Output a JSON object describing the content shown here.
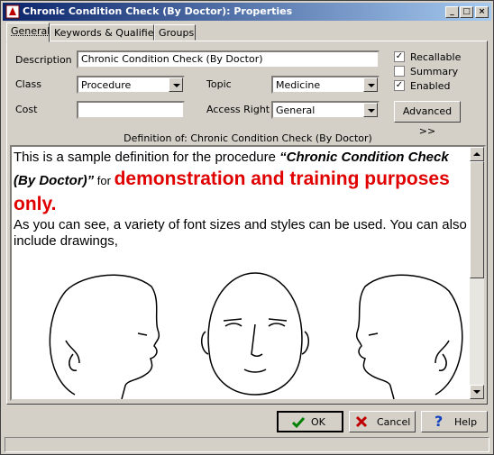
{
  "window": {
    "title": "Chronic Condition Check (By Doctor): Properties",
    "controls": [
      "_",
      "□",
      "×"
    ]
  },
  "tabs": [
    {
      "label": "General",
      "active": true
    },
    {
      "label": "Keywords & Qualifiers",
      "active": false
    },
    {
      "label": "Groups",
      "active": false
    }
  ],
  "form": {
    "description_label": "Description",
    "description_value": "Chronic Condition Check (By Doctor)",
    "class_label": "Class",
    "class_value": "Procedure",
    "topic_label": "Topic",
    "topic_value": "Medicine",
    "cost_label": "Cost",
    "cost_value": "",
    "access_label": "Access Right",
    "access_value": "General"
  },
  "checkboxes": [
    {
      "label": "Recallable",
      "checked": true
    },
    {
      "label": "Summary",
      "checked": false
    },
    {
      "label": "Enabled",
      "checked": true
    }
  ],
  "advanced_button": "Advanced >>",
  "definition": {
    "heading": "Definition of: Chronic Condition Check (By Doctor)",
    "intro": "This is a sample definition for the procedure ",
    "emphasis": "“Chronic Condition Check (By Doctor)”",
    "for_text": " for ",
    "red_text": "demonstration and training purposes only.",
    "paragraph2": "As you can see, a variety of font sizes and styles can be used. You can also include drawings,"
  },
  "buttons": {
    "ok": "OK",
    "cancel": "Cancel",
    "help": "Help"
  },
  "colors": {
    "accent_red": "#e00000",
    "ok_check": "#008000",
    "cancel_x": "#c00000",
    "help_q": "#1040c0"
  }
}
